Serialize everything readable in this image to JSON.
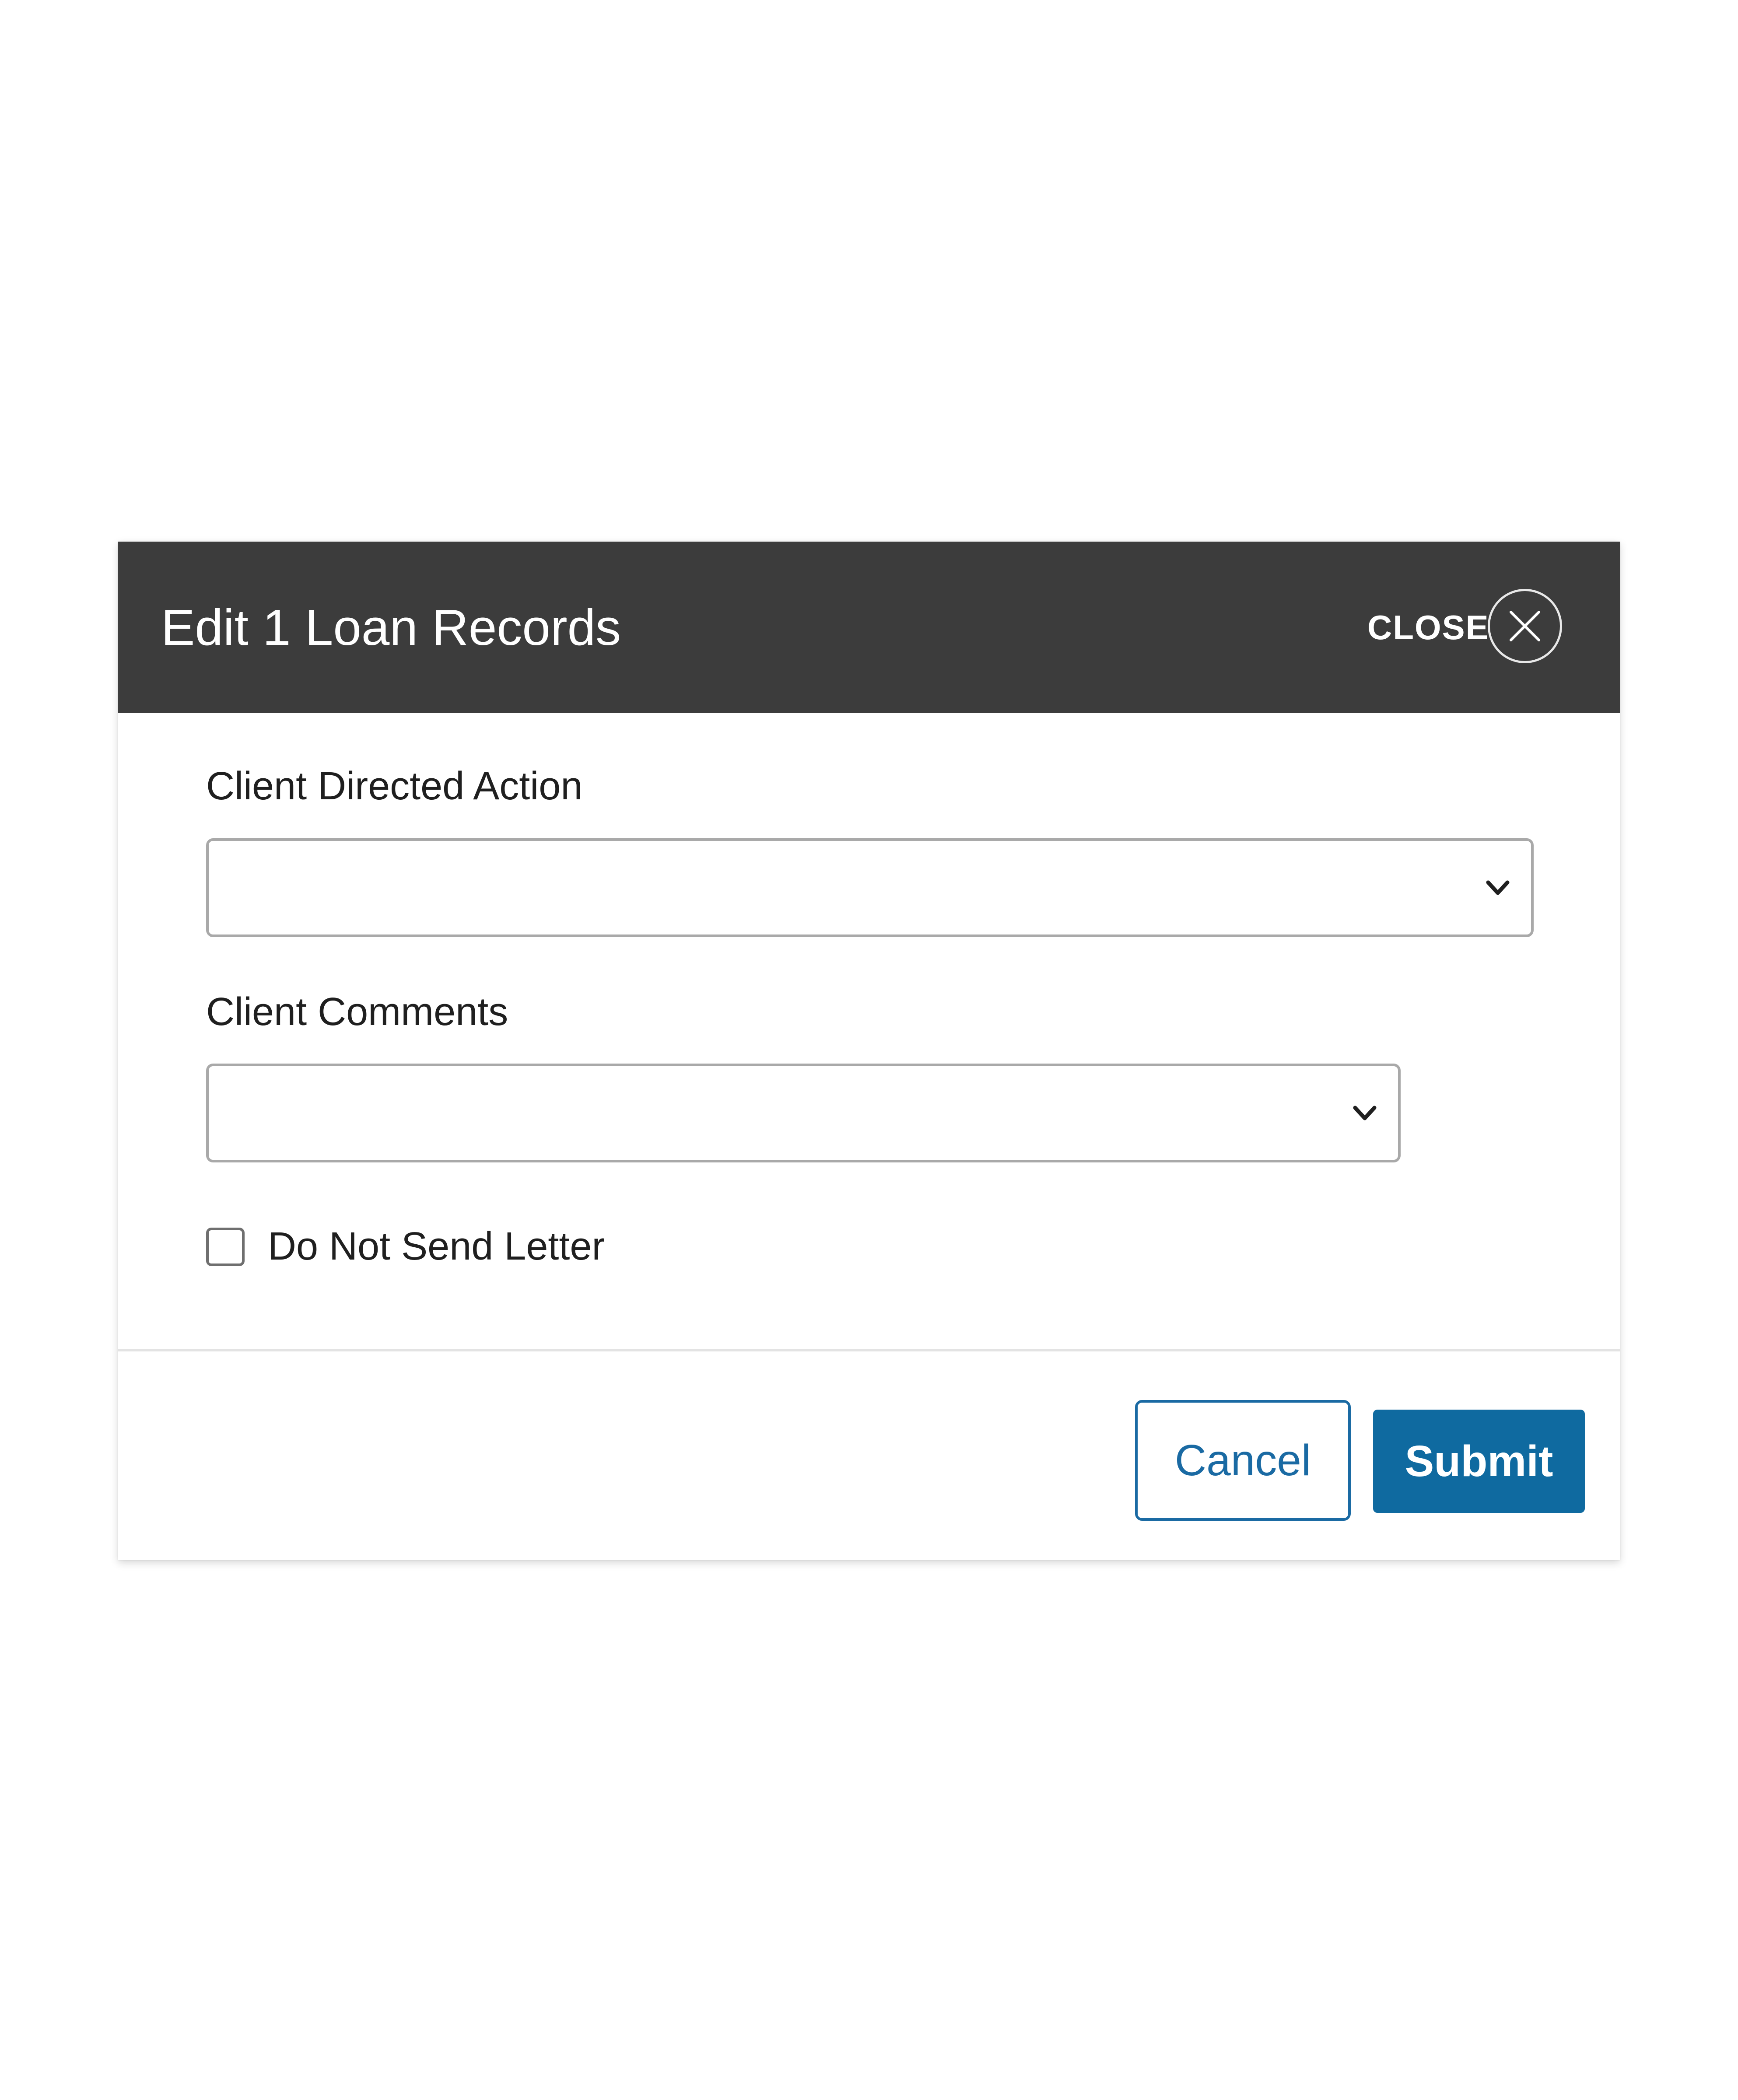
{
  "dialog": {
    "title": "Edit 1 Loan Records",
    "close_label": "CLOSE",
    "close_icon": "close-circle-x-icon"
  },
  "form": {
    "client_directed_action": {
      "label": "Client Directed Action",
      "value": ""
    },
    "client_comments": {
      "label": "Client Comments",
      "value": ""
    },
    "do_not_send_letter": {
      "label": "Do Not Send Letter",
      "checked": false
    }
  },
  "footer": {
    "cancel_label": "Cancel",
    "submit_label": "Submit"
  },
  "colors": {
    "header_bg": "#3c3c3c",
    "accent": "#0f6aa0",
    "cancel_text": "#1a6aa3"
  }
}
